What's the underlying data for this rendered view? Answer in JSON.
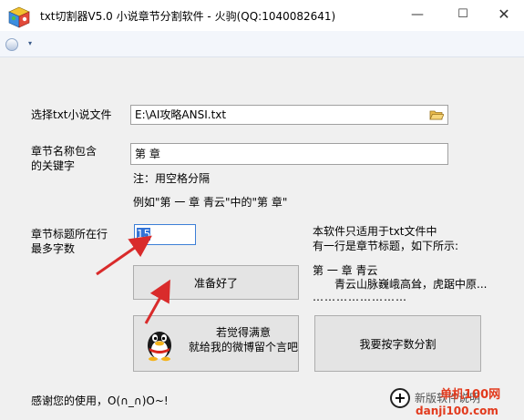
{
  "window": {
    "title": "txt切割器V5.0 小说章节分割软件 - 火驹(QQ:1040082641)",
    "min_glyph": "—",
    "max_glyph": "☐",
    "close_glyph": "✕"
  },
  "toolbar": {
    "dropdown_glyph": "▾"
  },
  "file": {
    "label": "选择txt小说文件",
    "value": "E:\\AI攻略ANSI.txt"
  },
  "keyword": {
    "label_line1": "章节名称包含",
    "label_line2": "的关键字",
    "value": "第 章",
    "note": "注：用空格分隔",
    "example": "例如\"第 一 章   青云\"中的\"第 章\""
  },
  "maxchars": {
    "label_line1": "章节标题所在行",
    "label_line2": "最多字数",
    "value": "15"
  },
  "info": {
    "line1": "本软件只适用于txt文件中",
    "line2": "有一行是章节标题，如下所示:",
    "sample_title": "第 一 章   青云",
    "sample_body": "青云山脉巍峨高耸，虎踞中原...",
    "sample_dots": "……………………"
  },
  "buttons": {
    "ready": "准备好了",
    "weibo_line1": "若觉得满意",
    "weibo_line2": "就给我的微博留个言吧",
    "split_by_chars": "我要按字数分割"
  },
  "footer": {
    "thanks": "感谢您的使用，O(∩_∩)O~!",
    "underlying_text": "新版软件说明"
  },
  "watermark": {
    "text1": "单机100网",
    "text2": "danji100.com",
    "mark": "+"
  },
  "colors": {
    "arrow": "#d92b2b",
    "selection": "#3373d6",
    "watermark": "#e23a1d"
  }
}
